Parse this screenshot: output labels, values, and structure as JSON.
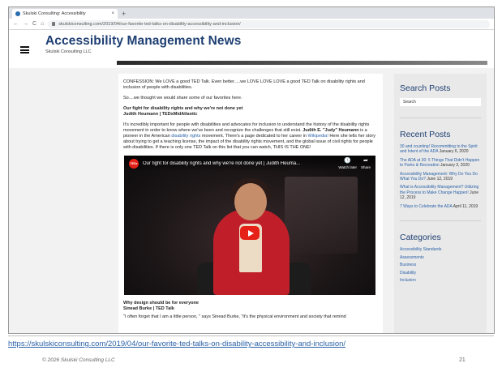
{
  "browser": {
    "tab_title": "Skulski Consulting: Accessibility",
    "tab_close": "×",
    "new_tab": "+",
    "nav_back": "←",
    "nav_forward": "→",
    "nav_reload": "C",
    "nav_home": "⌂",
    "url": "skulskiconsulting.com/2019/04/our-favorite-ted-talks-on-disability-accessibility-and-inclusion/"
  },
  "site": {
    "title": "Accessibility Management News",
    "subtitle": "Skulski Consulting LLC"
  },
  "article": {
    "intro": "CONFESSION: We LOVE a good TED Talk.  Even better.....we LOVE LOVE LOVE a good TED Talk on disability rights and inclusion of people with disabilities.",
    "lead": "So....we thought we would share some of our favorites here.",
    "talk1_title": "Our fight for disability rights and why we're not done yet",
    "talk1_speaker": "Judith Heumann | TEDxMidAtlantic",
    "p1_a": "It's incredibly important for people with disabilities and advocates for inclusion to understand the history of the disability rights movement in order to know where we've been and recognize the challenges that still exist.",
    "p1_name": "Judith E. \"Judy\" Heumann",
    "p1_b": " is a pioneer in the American ",
    "p1_link1": "disability rights",
    "p1_c": " movement.  There's a page dedicated to her career in ",
    "p1_link2": "Wikipedia!",
    "p1_d": "  Here she tells her story about trying to get a teaching license, the impact of the disability rights movement, and the global issue of civil rights for people with disabilities.  If there is only one TED Talk on this list that you can watch, THIS IS THE ONE!",
    "video": {
      "channel": "TEDx",
      "title": "Our fight for disability rights and why we're not done yet | Judith Heuma...",
      "watch_later": "Watch later",
      "share": "Share",
      "watch_icon": "🕓",
      "share_icon": "➦"
    },
    "talk2_title": "Why design should be for everyone",
    "talk2_speaker": "Sinead Burke | TED Talk",
    "p2": "\"I often forget that I am a little person, \" says Sinead Burke, \"it's the physical environment and society that remind"
  },
  "sidebar": {
    "search_heading": "Search Posts",
    "search_placeholder": "Search",
    "recent_heading": "Recent Posts",
    "recent": [
      {
        "title": "30 and counting! Recommitting to the Spirit and Intent of the ADA",
        "date": "January 6, 2020"
      },
      {
        "title": "The ADA at 30: 5 Things That Didn't Happen to Parks & Recreation",
        "date": "January 3, 2020"
      },
      {
        "title": "Accessibility Management: Why Do You Do What You Do?",
        "date": "June 12, 2019"
      },
      {
        "title": "What is Accessibility Management? Utilizing the Process to Make Change Happen!",
        "date": "June 12, 2019"
      },
      {
        "title": "7 Ways to Celebrate the ADA",
        "date": "April 11, 2019"
      }
    ],
    "categories_heading": "Categories",
    "categories": [
      "Accessibility Standards",
      "Assessments",
      "Business",
      "Disability",
      "Inclusion"
    ]
  },
  "slide": {
    "link": "https://skulskiconsulting.com/2019/04/our-favorite-ted-talks-on-disability-accessibility-and-inclusion/",
    "copyright": "© 2026 Skulski Consulting LLC",
    "page_number": "21"
  }
}
